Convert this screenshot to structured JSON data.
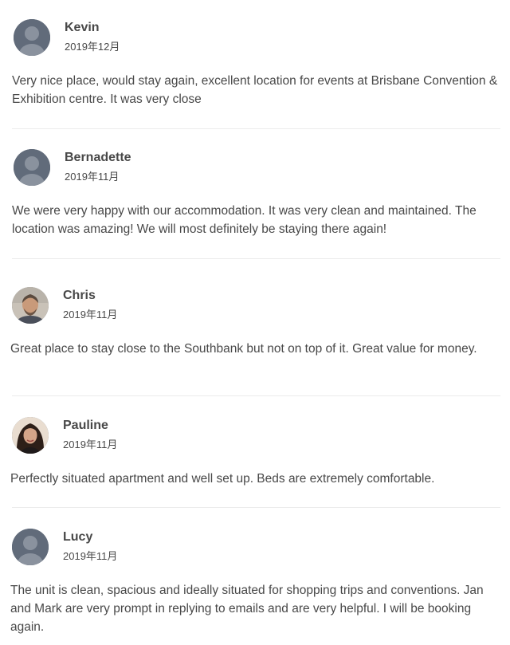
{
  "reviews": [
    {
      "name": "Kevin",
      "date": "2019年12月",
      "avatar": "default-avatar",
      "text": "Very nice place, would stay again, excellent location for events at Brisbane Convention & Exhibition centre. It was very close"
    },
    {
      "name": "Bernadette",
      "date": "2019年11月",
      "avatar": "default-avatar",
      "text": "We were very happy with our accommodation. It was very clean and maintained. The location was amazing! We will most definitely be staying there again!"
    },
    {
      "name": "Chris",
      "date": "2019年11月",
      "avatar": "photo-avatar",
      "text": "Great place to stay close to the Southbank but not on top of it. Great value for money."
    },
    {
      "name": "Pauline",
      "date": "2019年11月",
      "avatar": "photo-avatar",
      "text": "Perfectly situated apartment and well set up. Beds are extremely comfortable."
    },
    {
      "name": "Lucy",
      "date": "2019年11月",
      "avatar": "default-avatar",
      "text": "The unit is clean, spacious and ideally situated for shopping trips and conventions. Jan and Mark are very prompt in replying to emails and are very helpful. I will be booking again."
    }
  ],
  "colors": {
    "text": "#484848",
    "avatar_bg": "#616b7a",
    "avatar_fg": "#8a929e",
    "divider": "#ebebeb"
  }
}
